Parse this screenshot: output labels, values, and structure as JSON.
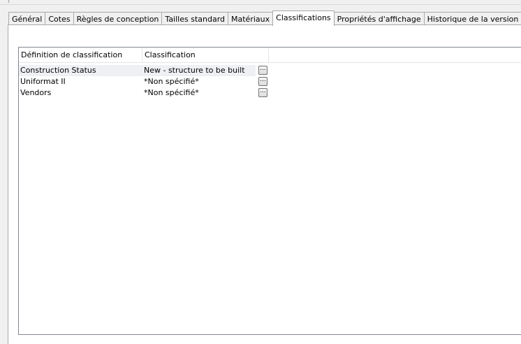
{
  "tabs": [
    {
      "label": "Général"
    },
    {
      "label": "Cotes"
    },
    {
      "label": "Règles de conception"
    },
    {
      "label": "Tailles standard"
    },
    {
      "label": "Matériaux"
    },
    {
      "label": "Classifications"
    },
    {
      "label": "Propriétés d'affichage"
    },
    {
      "label": "Historique de la version"
    }
  ],
  "active_tab": "Classifications",
  "grid": {
    "columns": [
      "Définition de classification",
      "Classification"
    ],
    "rows": [
      {
        "definition": "Construction Status",
        "classification": "New - structure to be built",
        "button": "..."
      },
      {
        "definition": "Uniformat II",
        "classification": "*Non spécifié*",
        "button": "..."
      },
      {
        "definition": "Vendors",
        "classification": "*Non spécifié*",
        "button": "..."
      }
    ]
  }
}
